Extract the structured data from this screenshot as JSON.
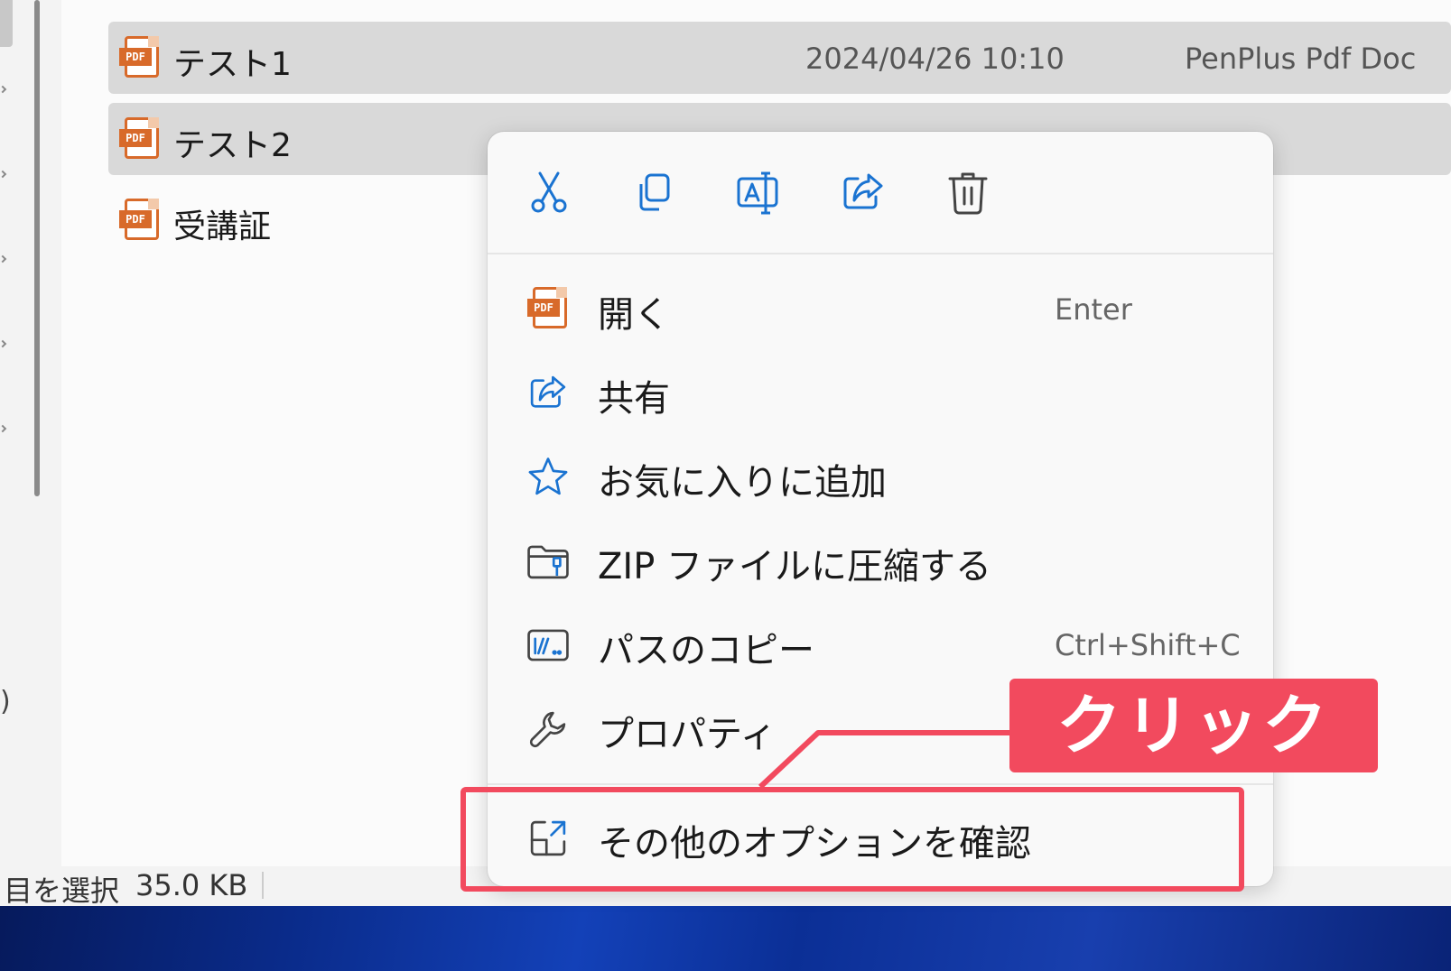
{
  "files": [
    {
      "name": "テスト1",
      "date": "2024/04/26 10:10",
      "type": "PenPlus Pdf Doc",
      "selected": true
    },
    {
      "name": "テスト2",
      "date": "",
      "type": "",
      "selected": true
    },
    {
      "name": "受講証",
      "date": "",
      "type": "",
      "selected": false
    }
  ],
  "file_icon": {
    "tag": "PDF"
  },
  "status": {
    "selection": "目を選択",
    "size": "35.0 KB"
  },
  "context_menu": {
    "toolbar": [
      {
        "icon": "scissors-icon",
        "action": "cut"
      },
      {
        "icon": "copy-icon",
        "action": "copy"
      },
      {
        "icon": "rename-icon",
        "action": "rename"
      },
      {
        "icon": "share-icon",
        "action": "share"
      },
      {
        "icon": "trash-icon",
        "action": "delete"
      }
    ],
    "items": [
      {
        "label": "開く",
        "shortcut": "Enter",
        "icon": "pdf-icon"
      },
      {
        "label": "共有",
        "shortcut": "",
        "icon": "share-icon"
      },
      {
        "label": "お気に入りに追加",
        "shortcut": "",
        "icon": "star-icon"
      },
      {
        "label": "ZIP ファイルに圧縮する",
        "shortcut": "",
        "icon": "zip-folder-icon"
      },
      {
        "label": "パスのコピー",
        "shortcut": "Ctrl+Shift+C",
        "icon": "path-copy-icon"
      },
      {
        "label": "プロパティ",
        "shortcut": "",
        "icon": "wrench-icon"
      },
      {
        "label": "その他のオプションを確認",
        "shortcut": "",
        "icon": "more-options-icon"
      }
    ]
  },
  "annotation": {
    "label": "クリック",
    "color": "#f24a5e"
  },
  "colors": {
    "pdf_orange": "#d86a2a",
    "accent_blue": "#1a73d1",
    "selected_row": "#d9d9d9"
  }
}
